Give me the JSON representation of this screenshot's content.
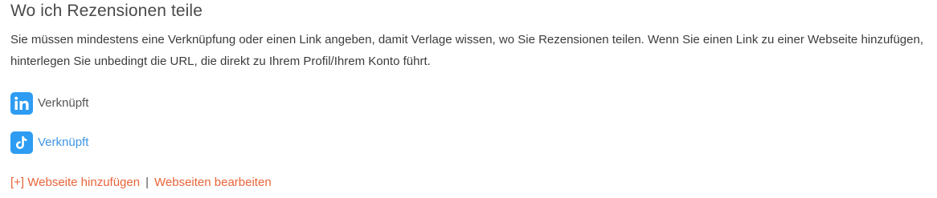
{
  "section": {
    "title": "Wo ich Rezensionen teile",
    "description": "Sie müssen mindestens eine Verknüpfung oder einen Link angeben, damit Verlage wissen, wo Sie Rezensionen teilen. Wenn Sie einen Link zu einer Webseite hinzufügen, hinterlegen Sie unbedingt die URL, die direkt zu Ihrem Profil/Ihrem Konto führt."
  },
  "social": [
    {
      "icon": "linkedin-icon",
      "status": "Verknüpft"
    },
    {
      "icon": "tiktok-icon",
      "status": "Verknüpft"
    }
  ],
  "links": {
    "add_website": "[+] Webseite hinzufügen",
    "separator": "|",
    "edit_websites": "Webseiten bearbeiten"
  },
  "colors": {
    "icon_bg": "#2d9cf2",
    "link_blue": "#3d95e6",
    "action_orange": "#e8643a",
    "text": "#3c3c3c"
  }
}
